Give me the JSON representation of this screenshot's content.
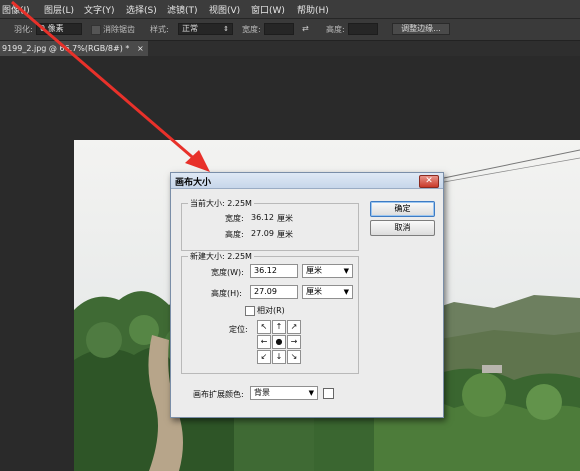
{
  "menubar": {
    "items": [
      "图像(I)",
      "图层(L)",
      "文字(Y)",
      "选择(S)",
      "滤镜(T)",
      "视图(V)",
      "窗口(W)",
      "帮助(H)"
    ]
  },
  "options": {
    "feather_label": "羽化:",
    "feather_value": "0 像素",
    "antialias_label": "消除锯齿",
    "style_label": "样式:",
    "style_value": "正常",
    "width_label": "宽度:",
    "height_label": "高度:",
    "refine_edge_label": "调整边缘..."
  },
  "document_tab": {
    "label": "9199_2.jpg @ 66.7%(RGB/8#) *",
    "close": "×"
  },
  "dialog": {
    "title": "画布大小",
    "close": "✕",
    "current": {
      "group_label": "当前大小: 2.25M",
      "width_label": "宽度:",
      "width_value": "36.12",
      "width_unit": "厘米",
      "height_label": "高度:",
      "height_value": "27.09",
      "height_unit": "厘米"
    },
    "new_size": {
      "group_label": "新建大小: 2.25M",
      "width_label": "宽度(W):",
      "width_value": "36.12",
      "width_unit": "厘米",
      "height_label": "高度(H):",
      "height_value": "27.09",
      "height_unit": "厘米",
      "relative_label": "相对(R)",
      "relative_checked": false,
      "anchor_label": "定位:",
      "anchor_glyphs": [
        "↖",
        "↑",
        "↗",
        "←",
        "●",
        "→",
        "↙",
        "↓",
        "↘"
      ]
    },
    "ok_label": "确定",
    "cancel_label": "取消",
    "extension_color_label": "画布扩展颜色:",
    "extension_color_value": "背景"
  },
  "colors": {
    "annotation_arrow": "#e8312a",
    "ui_dark": "#2b2b2b",
    "dialog_bg": "#ececec"
  }
}
